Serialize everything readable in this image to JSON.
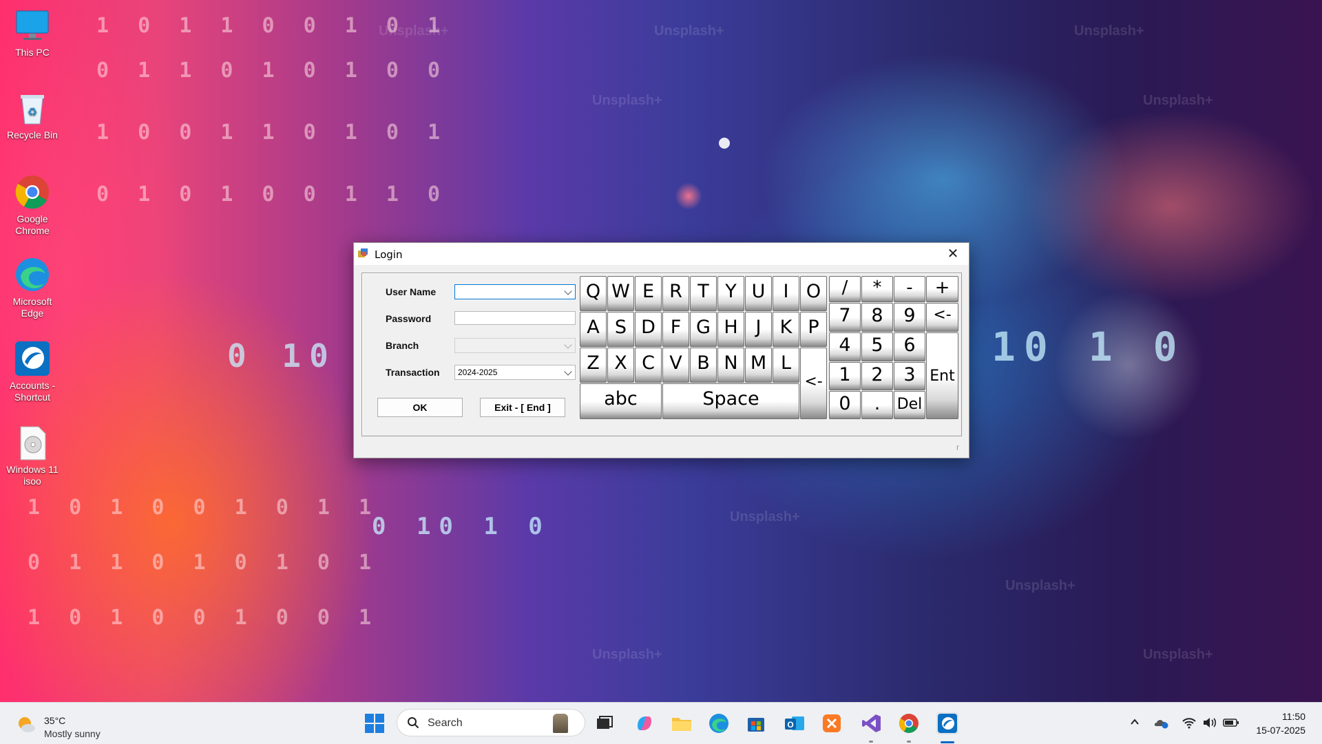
{
  "desktop": {
    "icons": [
      {
        "label": "This PC"
      },
      {
        "label": "Recycle Bin"
      },
      {
        "label": "Google Chrome"
      },
      {
        "label": "Microsoft Edge"
      },
      {
        "label": "Accounts - Shortcut"
      },
      {
        "label": "Windows 11 isoo"
      }
    ],
    "wallpaper_watermark": "Unsplash+",
    "wallpaper_digits": {
      "row1": "1 0 1 1 0 0 1 0 1",
      "row2": "0 1 1 0 1 0 1 0 0",
      "row3": "1 0 0 1 1 0 1 0 1",
      "row4": "0 1 0 1 0 0 1 1 0",
      "row5": "1 0 1 0 0 1 0 1 1",
      "row6": "0 1 1 0 1 0 1 0 1",
      "row7": "1 0 1 0 0 1 0 0 1",
      "row8": "0 10 1 0",
      "row9": "10 1 0",
      "row10": "0 10 1 0"
    }
  },
  "dialog": {
    "title": "Login",
    "close_glyph": "✕",
    "form": {
      "username_label": "User Name",
      "username_value": "",
      "password_label": "Password",
      "password_value": "",
      "branch_label": "Branch",
      "branch_value": "",
      "transaction_label": "Transaction",
      "transaction_value": "2024-2025"
    },
    "buttons": {
      "ok": "OK",
      "exit": "Exit - [ End ]"
    },
    "keyboard": {
      "row1": [
        "Q",
        "W",
        "E",
        "R",
        "T",
        "Y",
        "U",
        "I",
        "O"
      ],
      "row2": [
        "A",
        "S",
        "D",
        "F",
        "G",
        "H",
        "J",
        "K",
        "P"
      ],
      "row3": [
        "Z",
        "X",
        "C",
        "V",
        "B",
        "N",
        "M",
        "L"
      ],
      "abc": "abc",
      "space": "Space",
      "backspace_left": "<-",
      "numpad_ops": [
        "/",
        "*",
        "-",
        "+"
      ],
      "numpad_row1": [
        "7",
        "8",
        "9"
      ],
      "numpad_backspace": "<-",
      "numpad_row2": [
        "4",
        "5",
        "6"
      ],
      "numpad_row3": [
        "1",
        "2",
        "3"
      ],
      "enter": "Ent",
      "zero": "0",
      "dot": ".",
      "del": "Del"
    },
    "resize_grip": "r"
  },
  "taskbar": {
    "weather": {
      "temp": "35°C",
      "condition": "Mostly sunny"
    },
    "search_label": "Search",
    "clock": {
      "time": "11:50",
      "date": "15-07-2025"
    }
  }
}
